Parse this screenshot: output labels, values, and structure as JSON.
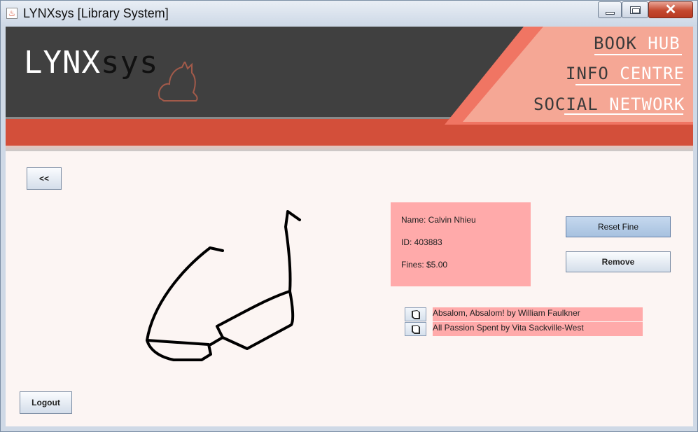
{
  "window": {
    "title": "LYNXsys [Library System]",
    "app_icon": "java-cup-icon",
    "controls": [
      "minimize-icon",
      "maximize-icon",
      "close-icon"
    ]
  },
  "banner": {
    "logo_light": "LYNX",
    "logo_dark": "sys",
    "nav": [
      {
        "first": "BOOK",
        "second": "HUB"
      },
      {
        "first": "INFO",
        "second": "CENTRE"
      },
      {
        "first": "SOCIAL",
        "second": "NETWORK"
      }
    ],
    "colors": {
      "dark": "#404040",
      "red": "#d34f3a",
      "salmon": "#f5a795"
    }
  },
  "nav_buttons": {
    "back_label": "<<",
    "logout_label": "Logout"
  },
  "profile": {
    "name_line": "Name: Calvin Nhieu",
    "id_line": "ID: 403883",
    "fines_line": "Fines: $5.00",
    "reset_fine_label": "Reset Fine",
    "remove_label": "Remove",
    "avatar_icon": "glasses-drawing-icon"
  },
  "borrowed_books": [
    {
      "title": "Absalom, Absalom! by William Faulkner",
      "icon": "book-icon"
    },
    {
      "title": "All Passion Spent by Vita Sackville-West",
      "icon": "book-icon"
    }
  ]
}
